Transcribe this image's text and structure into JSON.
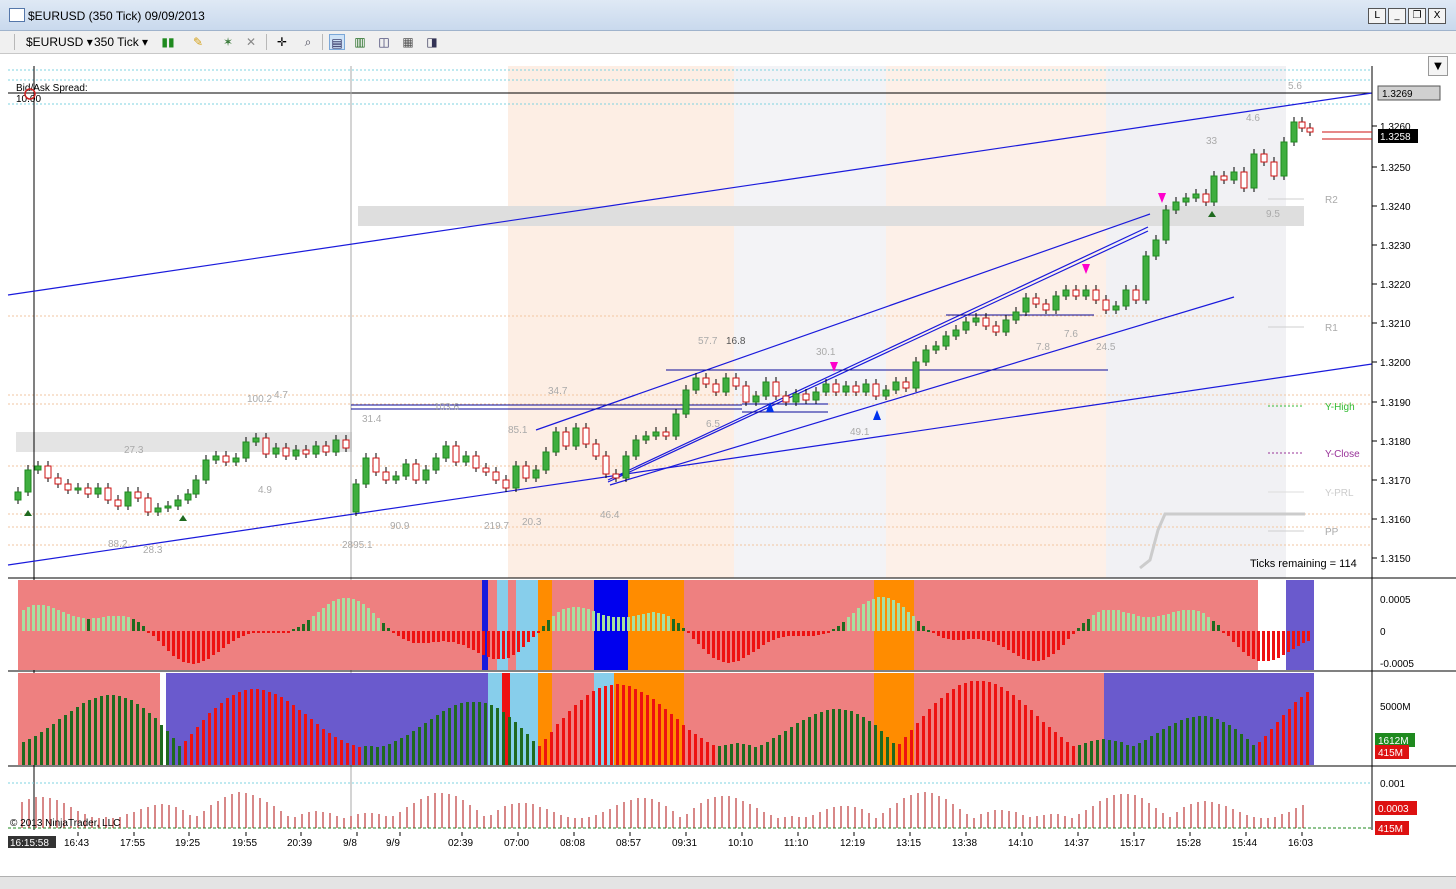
{
  "window": {
    "title": "$EURUSD (350 Tick)  09/09/2013",
    "buttons": [
      "L",
      "_",
      "❐",
      "X"
    ]
  },
  "toolbar": {
    "instrument": "$EURUSD",
    "interval": "350 Tick",
    "icons": [
      "bar-type-icon",
      "draw-pencil-icon",
      "crosshair-icon",
      "zoom-icon",
      "properties-icon",
      "indicators-icon",
      "strategies-icon",
      "templates-icon"
    ]
  },
  "chart": {
    "bid_ask_label": "Bid/Ask Spread:",
    "bid_ask_value": "10.00",
    "ticks_remaining": "Ticks remaining = 114",
    "copyright": "© 2013 NinjaTrader, LLC",
    "time_cursor": "16:15:58",
    "price_ticks": [
      "1.3260",
      "1.3250",
      "1.3240",
      "1.3230",
      "1.3220",
      "1.3210",
      "1.3200",
      "1.3190",
      "1.3180",
      "1.3170",
      "1.3160",
      "1.3150"
    ],
    "price_tags": [
      {
        "label": "1.3269",
        "style": "gray"
      },
      {
        "label": "1.3258",
        "style": "black"
      }
    ],
    "time_labels": [
      "16:43",
      "17:55",
      "19:25",
      "19:55",
      "20:39",
      "9/8",
      "9/9",
      "02:39",
      "07:00",
      "08:08",
      "08:57",
      "09:31",
      "10:10",
      "11:10",
      "12:19",
      "13:15",
      "13:38",
      "14:10",
      "14:37",
      "15:17",
      "15:28",
      "15:44",
      "16:03"
    ],
    "pivot_labels": [
      {
        "text": "R2",
        "color": "#aaaaaa"
      },
      {
        "text": "R1",
        "color": "#aaaaaa"
      },
      {
        "text": "Y-High",
        "color": "#33bb33"
      },
      {
        "text": "Y-Close",
        "color": "#993399"
      },
      {
        "text": "Y-PRL",
        "color": "#cccccc"
      },
      {
        "text": "PP",
        "color": "#aaaaaa"
      }
    ],
    "swing_labels": [
      "100.2",
      "4.7",
      "27.3",
      "4.9",
      "88.2",
      "28.3",
      "31.4",
      "103.6",
      "90.9",
      "219.7",
      "20.3",
      "2895.1",
      "34.7",
      "85.1",
      "46.4",
      "57.7",
      "16.8",
      "6.5",
      "30.1",
      "49.1",
      "7.8",
      "7.6",
      "24.5",
      "33",
      "4.6",
      "5.6",
      "9.5"
    ],
    "osc1_ticks": [
      "0.0005",
      "0",
      "-0.0005"
    ],
    "osc2_ticks": [
      "5000M"
    ],
    "osc2_tags": [
      "1612M",
      "415M"
    ],
    "osc3_ticks": [
      "0.001"
    ],
    "osc3_tags": [
      "0.0003",
      "415M"
    ]
  },
  "colors": {
    "trendline": "#1a1adc",
    "up_candle": "#1f8a1f",
    "down_candle": "#cc1111",
    "hist_salmon": "#ee8080",
    "hist_blue": "#6a5acd",
    "hist_orange": "#ff8c00",
    "hist_lightblue": "#87ceeb"
  }
}
